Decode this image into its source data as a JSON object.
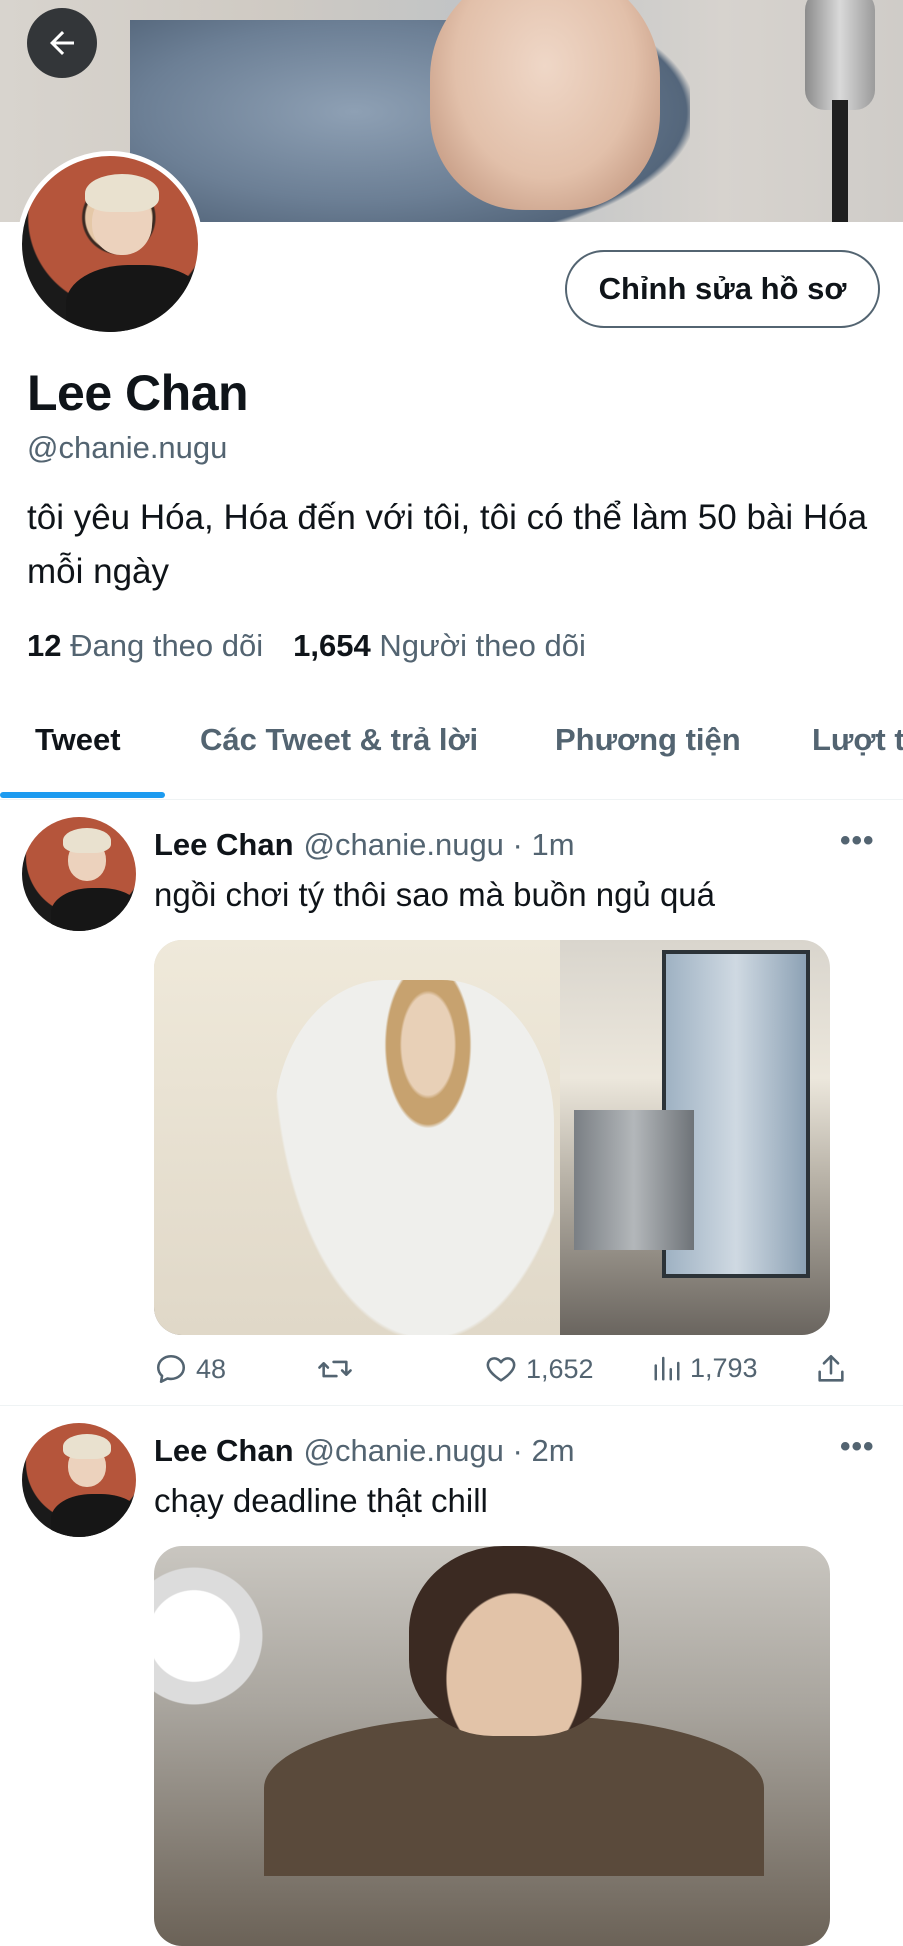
{
  "header": {
    "back_icon": "arrow-left-icon"
  },
  "profile": {
    "edit_button_label": "Chỉnh sửa hồ sơ",
    "display_name": "Lee Chan",
    "handle": "@chanie.nugu",
    "bio": "tôi yêu Hóa, Hóa đến với tôi, tôi có thể làm 50 bài Hóa mỗi ngày",
    "following_count": "12",
    "following_label": "Đang theo dõi",
    "followers_count": "1,654",
    "followers_label": "Người theo dõi"
  },
  "tabs": [
    {
      "label": "Tweet",
      "active": true
    },
    {
      "label": "Các Tweet & trả lời",
      "active": false
    },
    {
      "label": "Phương tiện",
      "active": false
    },
    {
      "label": "Lượt t",
      "active": false
    }
  ],
  "tweets": [
    {
      "name": "Lee Chan",
      "handle_time": "@chanie.nugu · 1m",
      "text": "ngồi chơi tý thôi sao mà buồn ngủ quá",
      "more": "•••",
      "replies": "48",
      "retweets": "",
      "likes": "1,652",
      "views": "1,793"
    },
    {
      "name": "Lee Chan",
      "handle_time": "@chanie.nugu · 2m",
      "text": "chạy deadline thật chill",
      "more": "•••"
    }
  ],
  "colors": {
    "accent": "#1d9bf0",
    "text_primary": "#0f1419",
    "text_secondary": "#536471"
  }
}
